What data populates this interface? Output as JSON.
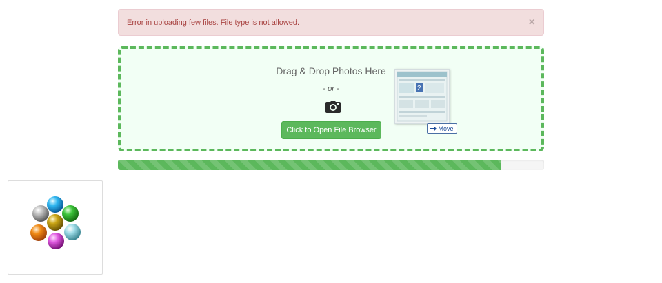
{
  "alert": {
    "message": "Error in uploading few files. File type is not allowed.",
    "close_label": "×"
  },
  "dropzone": {
    "title": "Drag & Drop Photos Here",
    "or_text": "- or -",
    "button_label": "Click to Open File Browser",
    "camera_icon": "camera-icon",
    "drag_preview": {
      "badge_number": "2",
      "move_label": "Move"
    }
  },
  "progress": {
    "percent": 90,
    "color": "#5cb85c"
  },
  "uploaded": [
    {
      "icon": "colored-spheres-image"
    }
  ],
  "colors": {
    "alert_bg": "#f2dede",
    "alert_text": "#a94442",
    "success": "#5cb85c",
    "dropzone_bg": "#f2fff5"
  }
}
